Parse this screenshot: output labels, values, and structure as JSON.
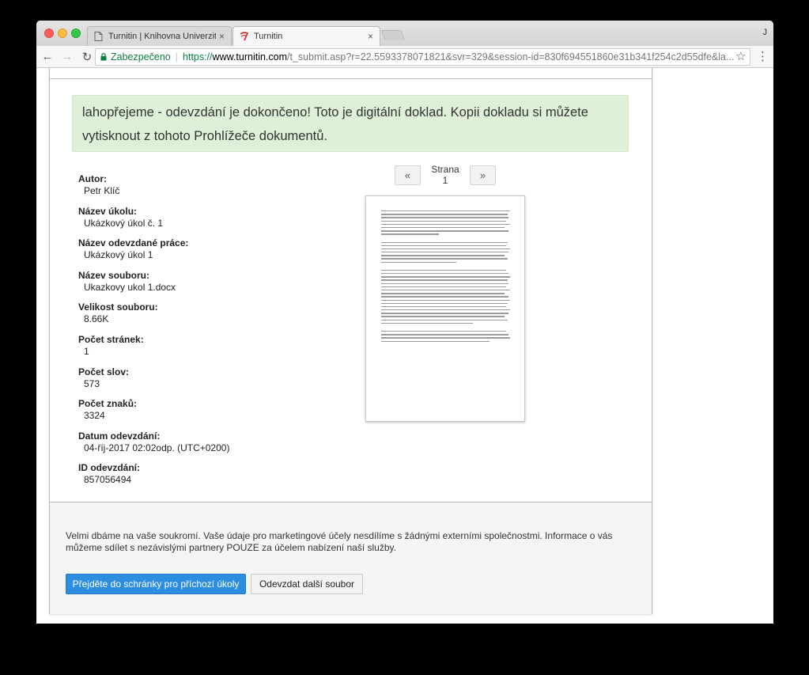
{
  "browser": {
    "tabs": [
      {
        "title": "Turnitin | Knihovna Univerzity K",
        "close": "×"
      },
      {
        "title": "Turnitin",
        "close": "×"
      }
    ],
    "profile_initial": "J",
    "nav": {
      "back": "←",
      "forward": "→",
      "reload": "↻"
    },
    "address": {
      "lock_icon": "🔒",
      "secure_label": "Zabezpečeno",
      "separator": "|",
      "scheme": "https://",
      "host": "www.turnitin.com",
      "path": "/t_submit.asp?r=22.5593378071821&svr=329&session-id=830f694551860e31b341f254c2d55dfe&la..."
    },
    "star": "☆",
    "menu": "⋮"
  },
  "page": {
    "success_message": "lahopřejeme - odevzdání je dokončeno! Toto je digitální doklad. Kopii dokladu si můžete vytisknout z tohoto Prohlížeče dokumentů.",
    "meta": [
      {
        "label": "Autor:",
        "value": "Petr Klíč"
      },
      {
        "label": "Název úkolu:",
        "value": "Ukázkový úkol č. 1"
      },
      {
        "label": "Název odevzdané práce:",
        "value": "Ukázkový úkol 1"
      },
      {
        "label": "Název souboru:",
        "value": "Ukazkovy ukol 1.docx"
      },
      {
        "label": "Velikost souboru:",
        "value": "8.66K"
      },
      {
        "label": "Počet stránek:",
        "value": "1"
      },
      {
        "label": "Počet slov:",
        "value": "573"
      },
      {
        "label": "Počet znaků:",
        "value": "3324"
      },
      {
        "label": "Datum odevzdání:",
        "value": "04-říj-2017 02:02odp. (UTC+0200)"
      },
      {
        "label": "ID odevzdání:",
        "value": "857056494"
      }
    ],
    "pager": {
      "prev": "«",
      "label": "Strana 1",
      "next": "»"
    },
    "privacy_text": "Velmi dbáme na vaše soukromí. Vaše údaje pro marketingové účely nesdílíme s žádnými externími společnostmi. Informace o vás můžeme sdílet s nezávislými partnery POUZE za účelem nabízení naší služby.",
    "buttons": {
      "primary": "Přejděte do schránky pro příchozí úkoly",
      "secondary": "Odevzdat další soubor"
    }
  },
  "colors": {
    "success_bg": "#dff0d8",
    "primary_button": "#2d8ee0",
    "secure_green": "#0b8043"
  }
}
